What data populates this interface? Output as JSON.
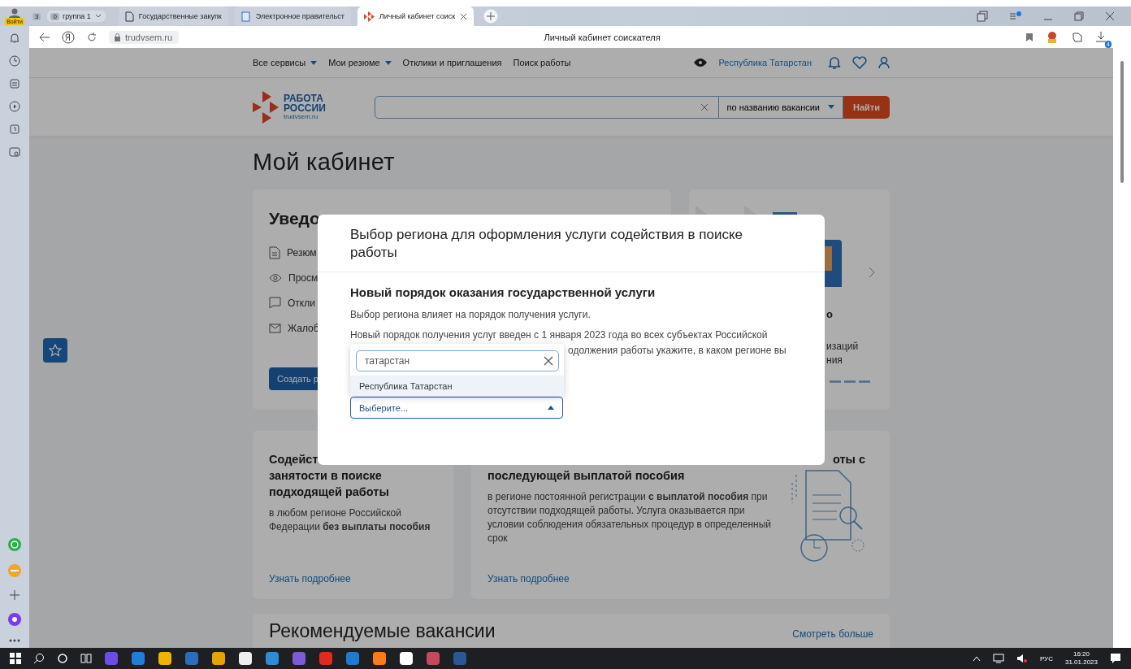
{
  "browser": {
    "profile_label": "Войти",
    "tab_count": "3",
    "tab_group": {
      "count": "0",
      "label": "группа 1"
    },
    "tabs": [
      {
        "title": "Государственные закупк",
        "selected": false
      },
      {
        "title": "Электронное правительст",
        "selected": false
      },
      {
        "title": "Личный кабинет соиск",
        "selected": true
      }
    ],
    "address": "trudvsem.ru",
    "page_title": "Личный кабинет соискателя",
    "downloads_badge": "4"
  },
  "nav": {
    "items": [
      {
        "label": "Все сервисы",
        "dropdown": true
      },
      {
        "label": "Мои резюме",
        "dropdown": true
      },
      {
        "label": "Отклики и приглашения",
        "dropdown": false
      },
      {
        "label": "Поиск работы",
        "dropdown": false
      }
    ],
    "region": "Республика Татарстан"
  },
  "header": {
    "logo_line1": "РАБОТА",
    "logo_line2": "РОССИИ",
    "logo_domain": "trudvsem.ru",
    "search_mode": "по названию вакансии",
    "search_button": "Найти"
  },
  "page_title": "Мой кабинет",
  "notifications_card": {
    "title": "Уведо",
    "items": [
      "Резюм",
      "Просм",
      "Откли",
      "Жалоб"
    ],
    "button": "Создать р"
  },
  "promo_card": {
    "heading_fragment": "о",
    "text_fragments": [
      "изаций",
      "ния"
    ]
  },
  "service_cards": [
    {
      "title_lines": [
        "Содейст",
        "занятости в поиске",
        "подходящей работы"
      ],
      "text": "в любом регионе Российской Федерации **без выплаты пособия**",
      "link": "Узнать подробнее"
    },
    {
      "title_lines": [
        "оты с",
        "последующей выплатой пособия"
      ],
      "text": "в регионе постоянной регистрации **с выплатой пособия** при отсутствии подходящей работы. Услуга оказывается при условии соблюдения обязательных процедур в определенный срок",
      "link": "Узнать подробнее"
    }
  ],
  "recommended": {
    "title": "Рекомендуемые вакансии",
    "more_link": "Смотреть больше"
  },
  "modal": {
    "title": "Выбор региона для оформления услуги содействия в поиске работы",
    "subtitle": "Новый порядок оказания государственной услуги",
    "paragraph": "Выбор региона влияет на порядок получения услуги.",
    "paragraph2_line1": "Новый порядок получения услуг введен с 1 января 2023 года во всех субъектах Российской",
    "paragraph2_line2": "одолжения работы укажите, в каком регионе вы",
    "select": {
      "placeholder": "Выберите...",
      "expanded": true,
      "query": "татарстан",
      "options": [
        {
          "label": "Республика Татарстан",
          "selected": true
        }
      ]
    }
  },
  "taskbar": {
    "language": "РУС",
    "time": "16:20",
    "date": "31.01.2023"
  }
}
